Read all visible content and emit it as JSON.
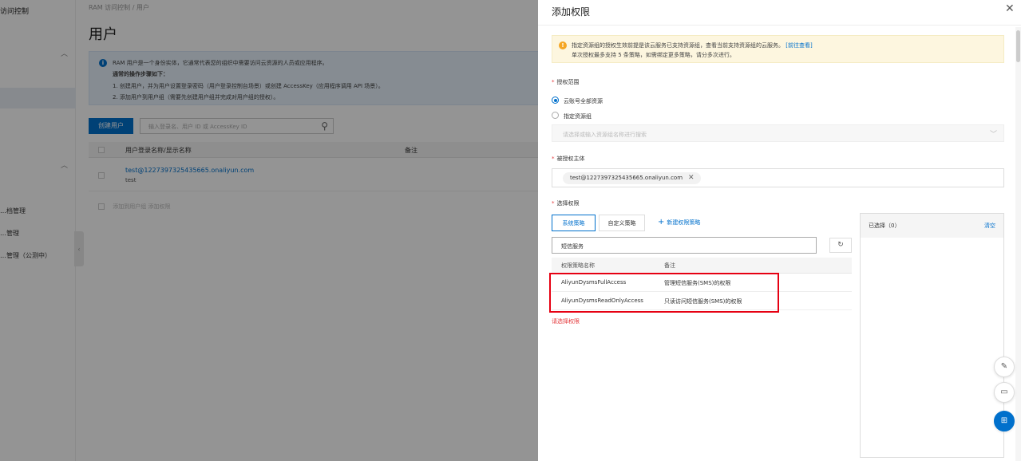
{
  "background": {
    "sidebar": {
      "title": "访问控制",
      "items": [
        "…档管理",
        "…管理",
        "…管理（公测中）"
      ]
    },
    "breadcrumb": "RAM 访问控制 / 用户",
    "page_title": "用户",
    "info": {
      "line1": "RAM 用户是一个身份实体，它通常代表您的组织中需要访问云资源的人员或应用程序。",
      "line2": "通常的操作步骤如下：",
      "line3": "1. 创建用户，并为用户设置登录密码（用户登录控制台场景）或创建 AccessKey（应用程序调用 API 场景）。",
      "line4": "2. 添加用户到用户组（需要先创建用户组并完成对用户组的授权）。"
    },
    "create_user_label": "创建用户",
    "search_placeholder": "输入登录名、用户 ID 或 AccessKey ID",
    "table": {
      "col_name": "用户登录名称/显示名称",
      "col_note": "备注",
      "rows": [
        {
          "login": "test@1227397325435665.onaliyun.com",
          "display": "test"
        }
      ]
    },
    "bulk_actions": "添加到用户组   添加权限"
  },
  "drawer": {
    "title": "添加权限",
    "warning": {
      "line1": "指定资源组的授权生效前提是该云服务已支持资源组，查看当前支持资源组的云服务。",
      "link": "[前往查看]",
      "line2": "单次授权最多支持 5 条策略，如需绑定更多策略，请分多次进行。"
    },
    "scope_label": "授权范围",
    "scope_options": [
      "云账号全部资源",
      "指定资源组"
    ],
    "resource_group_placeholder": "请选择或输入资源组名称进行搜索",
    "principal_label": "被授权主体",
    "principal_tag": "test@1227397325435665.onaliyun.com",
    "permission_label": "选择权限",
    "tabs": [
      "系统策略",
      "自定义策略"
    ],
    "new_policy_label": "新建权限策略",
    "filter_value": "短信服务",
    "policy_table": {
      "col_name": "权限策略名称",
      "col_note": "备注",
      "rows": [
        {
          "name": "AliyunDysmsFullAccess",
          "note": "管理短信服务(SMS)的权限"
        },
        {
          "name": "AliyunDysmsReadOnlyAccess",
          "note": "只读访问短信服务(SMS)的权限"
        }
      ]
    },
    "error_text": "请选择权限",
    "selected": {
      "title": "已选择（0）",
      "clear": "清空"
    }
  }
}
